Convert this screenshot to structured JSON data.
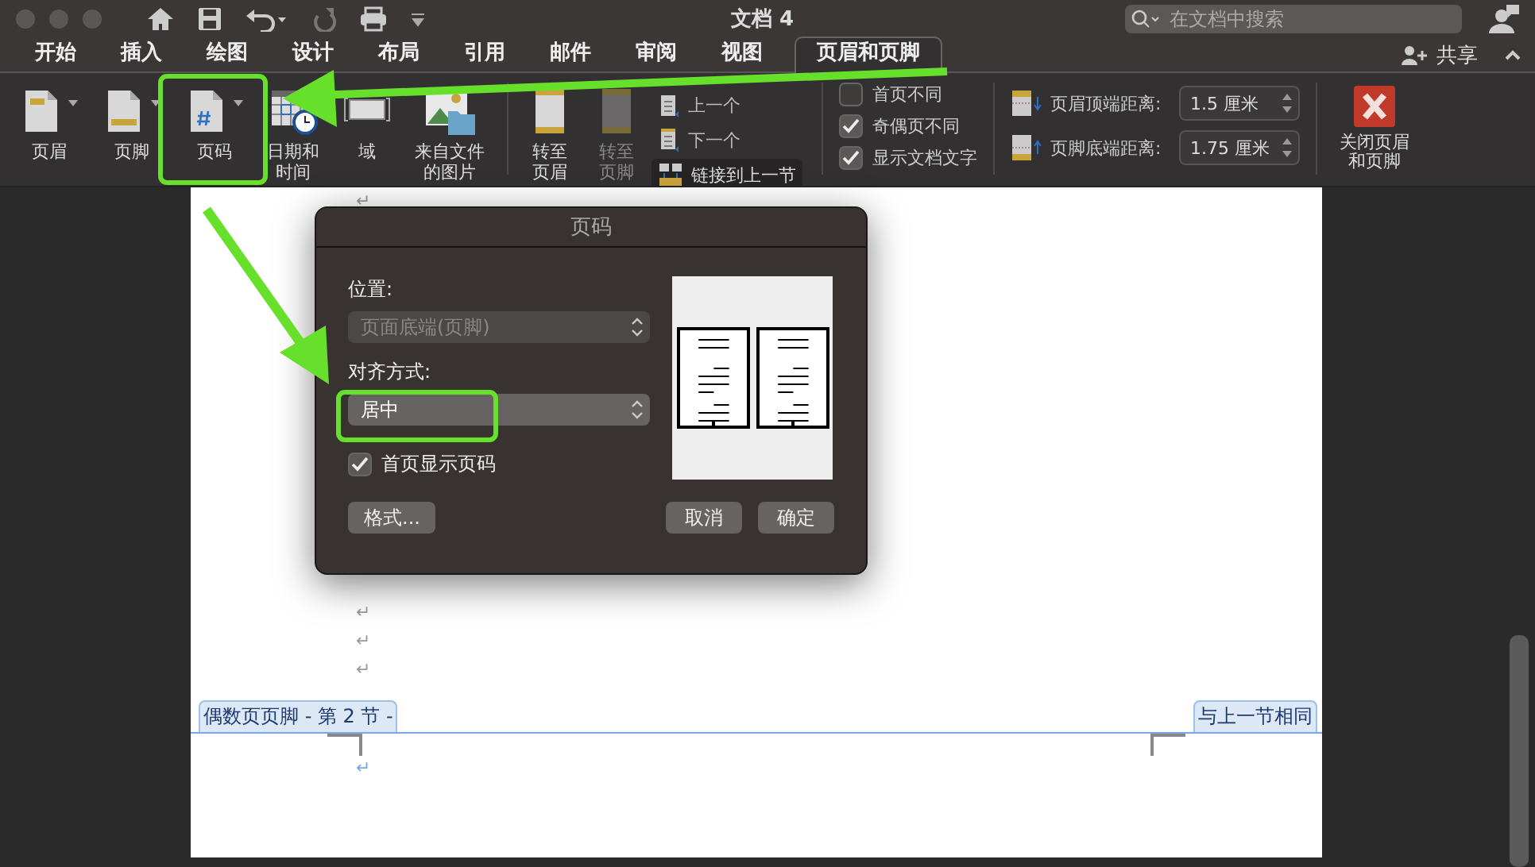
{
  "window": {
    "title": "文档 4",
    "search": {
      "placeholder": "在文档中搜索"
    }
  },
  "tabs": [
    {
      "label": "开始",
      "selected": false
    },
    {
      "label": "插入",
      "selected": false
    },
    {
      "label": "绘图",
      "selected": false
    },
    {
      "label": "设计",
      "selected": false
    },
    {
      "label": "布局",
      "selected": false
    },
    {
      "label": "引用",
      "selected": false
    },
    {
      "label": "邮件",
      "selected": false
    },
    {
      "label": "审阅",
      "selected": false
    },
    {
      "label": "视图",
      "selected": false
    },
    {
      "label": "页眉和页脚",
      "selected": true
    }
  ],
  "share": "共享",
  "ribbon": {
    "insert_buttons": [
      {
        "label": "页眉",
        "kind": "header",
        "dropdown": true
      },
      {
        "label": "页脚",
        "kind": "footer",
        "dropdown": true
      },
      {
        "label": "页码",
        "kind": "page-number",
        "dropdown": true
      },
      {
        "label": "日期和时间",
        "kind": "date-time",
        "dropdown": false
      },
      {
        "label": "域",
        "kind": "field",
        "dropdown": false
      },
      {
        "label": "来自文件的图片",
        "kind": "picture",
        "dropdown": false
      }
    ],
    "navigation_buttons": [
      {
        "label": "转至页眉",
        "disabled": false
      },
      {
        "label": "转至页脚",
        "disabled": true
      }
    ],
    "section_buttons": [
      {
        "label": "上一个",
        "kind": "previous"
      },
      {
        "label": "下一个",
        "kind": "next"
      },
      {
        "label": "链接到上一节",
        "kind": "link"
      }
    ],
    "options": [
      {
        "label": "首页不同",
        "checked": false
      },
      {
        "label": "奇偶页不同",
        "checked": true
      },
      {
        "label": "显示文档文字",
        "checked": true
      }
    ],
    "positions": [
      {
        "label": "页眉顶端距离:",
        "value": "1.5 厘米",
        "kind": "header"
      },
      {
        "label": "页脚底端距离:",
        "value": "1.75 厘米",
        "kind": "footer"
      }
    ],
    "close_button": "关闭页眉和页脚"
  },
  "document": {
    "top_mark": "↵",
    "marks": [
      "↵",
      "↵",
      "↵"
    ],
    "footer_label": "偶数页页脚 - 第 2 节 -",
    "same_as_previous": "与上一节相同",
    "footer_mark": "↵"
  },
  "dialog": {
    "title": "页码",
    "position_label": "位置:",
    "position": {
      "value": "页面底端(页脚)",
      "disabled": true
    },
    "alignment_label": "对齐方式:",
    "alignment": {
      "value": "居中",
      "disabled": false
    },
    "show_on_first_page": {
      "label": "首页显示页码",
      "checked": true
    },
    "buttons": [
      "格式...",
      "取消",
      "确定"
    ]
  }
}
